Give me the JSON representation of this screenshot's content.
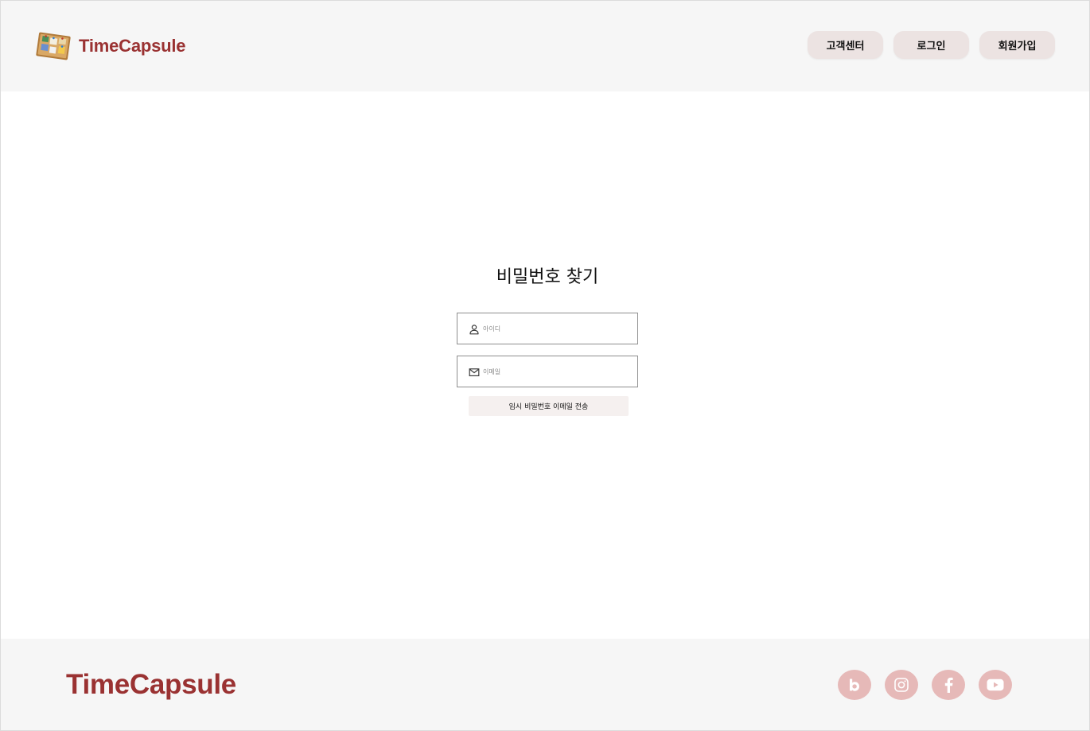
{
  "header": {
    "logo_text": "TimeCapsule",
    "logo_icon": "corkboard-icon",
    "nav": [
      {
        "label": "고객센터"
      },
      {
        "label": "로그인"
      },
      {
        "label": "회원가입"
      }
    ]
  },
  "main": {
    "title": "비밀번호 찾기",
    "id_field": {
      "placeholder": "아이디",
      "icon": "user-icon",
      "value": ""
    },
    "email_field": {
      "placeholder": "이메일",
      "icon": "mail-icon",
      "value": ""
    },
    "submit_label": "임시 비밀번호 이메일 전송"
  },
  "footer": {
    "logo_text": "TimeCapsule",
    "social": [
      {
        "icon": "blog-icon"
      },
      {
        "icon": "instagram-icon"
      },
      {
        "icon": "facebook-icon"
      },
      {
        "icon": "youtube-icon"
      }
    ]
  },
  "colors": {
    "brand": "#9a3232",
    "header_bg": "#f6f6f6",
    "nav_button_bg": "#ece3e2",
    "submit_bg": "#f5f0ef",
    "social_bg": "#e6b9b8"
  }
}
